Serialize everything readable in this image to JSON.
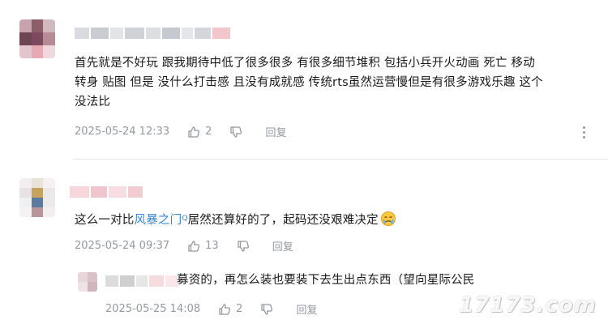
{
  "comments": [
    {
      "content": "首先就是不好玩 跟我期待中低了很多很多 有很多细节堆积 包括小兵开火动画 死亡 移动转身 贴图 但是 没什么打击感 且没有成就感 传统rts虽然运营慢但是有很多游戏乐趣 这个没法比",
      "content_lines": [
        "首先就是不好玩 跟我期待中低了很多很多 有很多细节堆积 包括小兵开火动画 死亡 移动",
        "转身 贴图 但是 没什么打击感 且没有成就感 传统rts虽然运营慢但是有很多游戏乐趣 这个",
        "没法比"
      ],
      "time": "2025-05-24 12:33",
      "likes": "2",
      "reply_label": "回复"
    },
    {
      "content_prefix": "这么一对比",
      "link_text": "风暴之门",
      "link_mark": "Q",
      "content_suffix": "居然还算好的了，起码还没艰难决定",
      "time": "2025-05-24 09:37",
      "likes": "13",
      "reply_label": "回复"
    },
    {
      "content": "募资的，再怎么装也要装下去生出点东西（望向星际公民",
      "time": "2025-05-25 14:08",
      "likes": "2",
      "reply_label": "回复"
    }
  ],
  "icons": {
    "like": "thumbs-up-icon",
    "dislike": "thumbs-down-icon",
    "more": "more-vertical-icon",
    "emoji": "crying-face-emoji-icon"
  },
  "colors": {
    "text": "#18191c",
    "meta": "#9499a0",
    "link": "#2f86d9",
    "divider": "#e3e5e7"
  },
  "watermark": "17173.com"
}
